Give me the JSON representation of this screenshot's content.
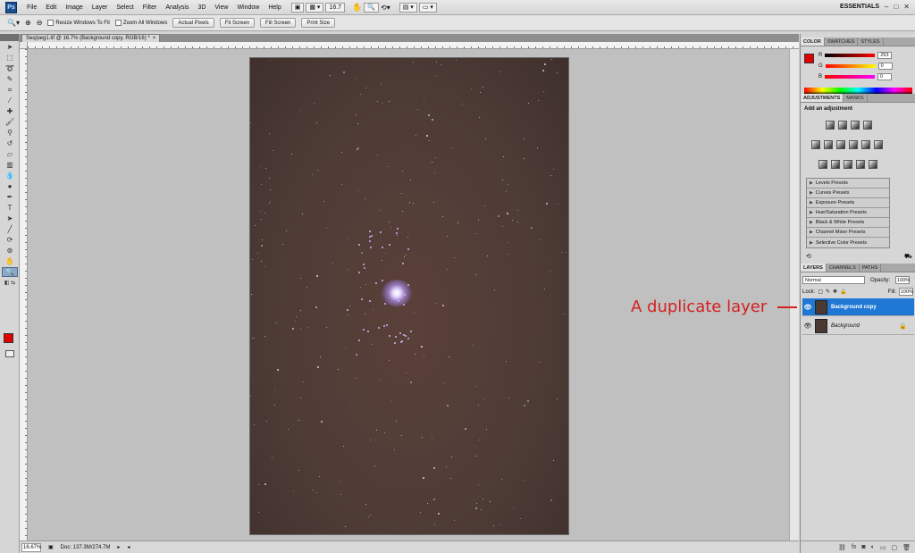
{
  "menubar": {
    "logo": "Ps",
    "items": [
      "File",
      "Edit",
      "Image",
      "Layer",
      "Select",
      "Filter",
      "Analysis",
      "3D",
      "View",
      "Window",
      "Help"
    ],
    "zoom_value": "16.7",
    "workspace": "ESSENTIALS",
    "window_controls": [
      "–",
      "□",
      "✕"
    ]
  },
  "optionsbar": {
    "resize_windows": "Resize Windows To Fit",
    "zoom_all": "Zoom All Windows",
    "buttons": [
      "Actual Pixels",
      "Fit Screen",
      "Fill Screen",
      "Print Size"
    ]
  },
  "document": {
    "tab_title": "Seq/peg1.tif @ 16.7% (Background copy, RGB/16) *",
    "tab_close": "×",
    "status_zoom": "16.67%",
    "status_doc": "Doc: 137.3M/274.7M"
  },
  "color_panel": {
    "tabs": [
      "COLOR",
      "SWATCHES",
      "STYLES"
    ],
    "r_label": "R",
    "g_label": "G",
    "b_label": "B",
    "r_value": "253",
    "g_value": "0",
    "b_value": "0",
    "fg_color": "#e00000"
  },
  "adjustments_panel": {
    "tabs": [
      "ADJUSTMENTS",
      "MASKS"
    ],
    "title": "Add an adjustment",
    "presets": [
      "Levels Presets",
      "Curves Presets",
      "Exposure Presets",
      "Hue/Saturation Presets",
      "Black & White Presets",
      "Channel Mixer Presets",
      "Selective Color Presets"
    ]
  },
  "layers_panel": {
    "tabs": [
      "LAYERS",
      "CHANNELS",
      "PATHS"
    ],
    "blend_mode": "Normal",
    "opacity_label": "Opacity:",
    "opacity_value": "100%",
    "lock_label": "Lock:",
    "fill_label": "Fill:",
    "fill_value": "100%",
    "layers": [
      {
        "name": "Background copy",
        "selected": true
      },
      {
        "name": "Background",
        "selected": false
      }
    ]
  },
  "annotation": {
    "text": "A duplicate layer",
    "color": "#d42020"
  }
}
